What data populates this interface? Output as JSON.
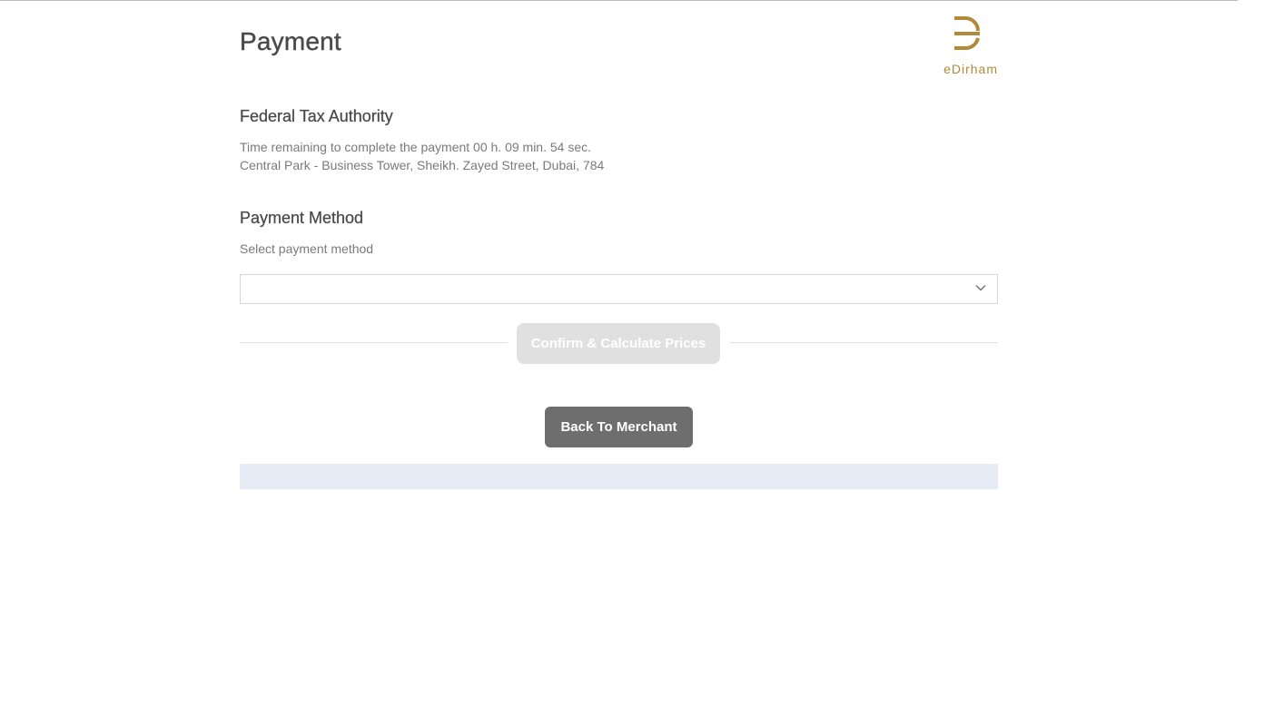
{
  "header": {
    "title": "Payment",
    "logo_text": "eDirham"
  },
  "merchant": {
    "name": "Federal Tax Authority",
    "time_remaining": "Time remaining to complete the payment 00 h. 09 min. 54 sec.",
    "address": "Central Park - Business Tower, Sheikh. Zayed Street, Dubai, 784"
  },
  "payment_method": {
    "heading": "Payment Method",
    "label": "Select payment method",
    "selected_value": ""
  },
  "actions": {
    "confirm_label": "Confirm & Calculate Prices",
    "back_label": "Back To Merchant"
  },
  "colors": {
    "brand_gold": "#b08a3a",
    "back_button_bg": "#6e6e6e",
    "confirm_disabled_bg": "#e0e0e0",
    "footer_bar_bg": "#e6ecf6"
  },
  "icons": {
    "logo": "edirham-logo-icon",
    "select_chevron": "chevron-down-icon"
  }
}
